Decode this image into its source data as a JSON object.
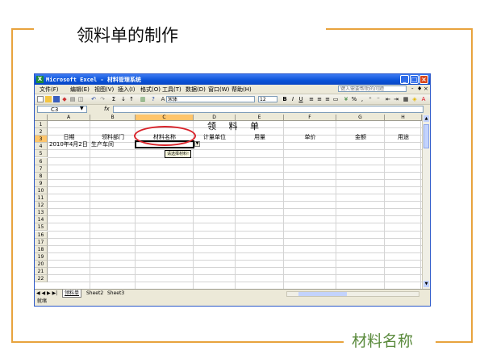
{
  "slide": {
    "title": "领料单的制作",
    "caption": "材料名称",
    "accent_color": "#e8a33d",
    "caption_color": "#5a8a3c"
  },
  "window": {
    "title": "Microsoft Excel - 材料管理系统",
    "app_icon": "excel-icon",
    "buttons": {
      "minimize": "_",
      "maximize": "□",
      "close": "×"
    }
  },
  "menu": {
    "items": [
      "文件(F)",
      "编辑(E)",
      "视图(V)",
      "插入(I)",
      "格式(O)",
      "工具(T)",
      "数据(D)",
      "窗口(W)",
      "帮助(H)"
    ],
    "help_placeholder": "键入需要帮助的问题",
    "min_label": "-",
    "restore_label": "♦",
    "close_label": "×"
  },
  "toolbar": {
    "font_name": "宋体",
    "font_size": "12",
    "bold": "B",
    "italic": "I",
    "underline": "U",
    "percent": "%",
    "sum": "Σ"
  },
  "formula_bar": {
    "cell_ref": "C3",
    "fx": "fx",
    "value": ""
  },
  "sheet": {
    "columns": [
      "A",
      "B",
      "C",
      "D",
      "E",
      "F",
      "G",
      "H"
    ],
    "active_column": "C",
    "rows": [
      "1",
      "2",
      "3",
      "4",
      "5",
      "6",
      "7",
      "8",
      "9",
      "10",
      "11",
      "12",
      "13",
      "14",
      "15",
      "16",
      "17",
      "18",
      "19",
      "20",
      "21",
      "22"
    ],
    "active_row": "3",
    "title": "领 料 单",
    "headers": [
      "日期",
      "领料部门",
      "材料名称",
      "计量单位",
      "用量",
      "单价",
      "金额",
      "用途"
    ],
    "row3": {
      "date": "2010年4月2日",
      "department": "生产车间"
    },
    "tooltip": "请选择材料!",
    "highlight_color": "#d9232a"
  },
  "tabs": {
    "nav": "◀ ◀ ▶ ▶|",
    "items": [
      "领料单",
      "Sheet2",
      "Sheet3"
    ],
    "active": "领料单"
  },
  "status": {
    "text": "就绪"
  }
}
